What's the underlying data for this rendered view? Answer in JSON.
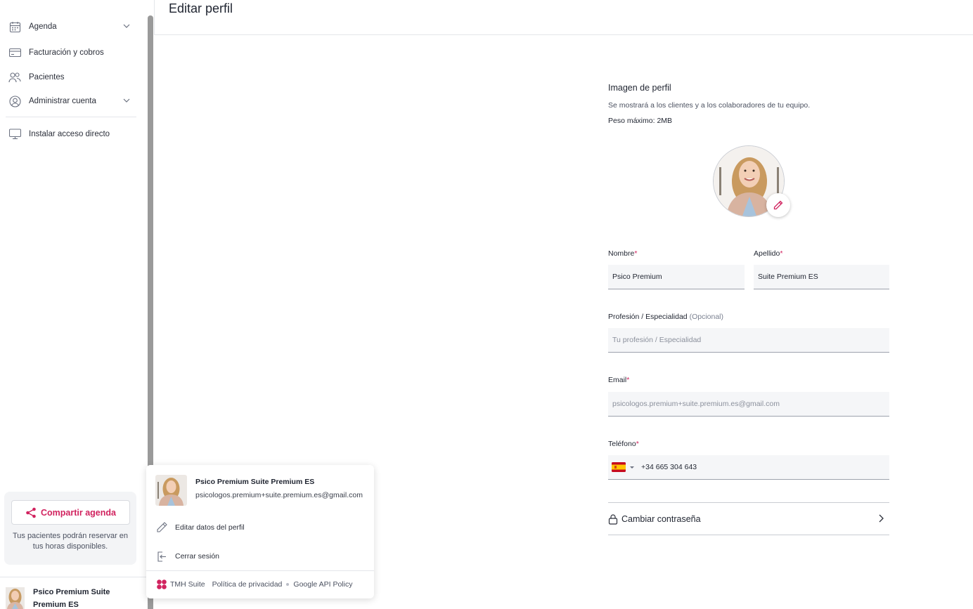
{
  "sidebar": {
    "items": [
      {
        "label": "Agenda",
        "icon": "calendar-icon"
      },
      {
        "label": "Facturación y cobros",
        "icon": "credit-card-icon"
      },
      {
        "label": "Pacientes",
        "icon": "users-icon"
      },
      {
        "label": "Administrar cuenta",
        "icon": "user-circle-icon"
      },
      {
        "label": "Instalar acceso directo",
        "icon": "monitor-icon"
      }
    ],
    "share": {
      "button_label": "Compartir agenda",
      "description": "Tus pacientes podrán reservar en tus horas disponibles."
    },
    "user_name": "Psico Premium Suite Premium ES"
  },
  "header": {
    "title": "Editar perfil"
  },
  "profile_image": {
    "title": "Imagen de perfil",
    "subtitle": "Se mostrará a los clientes y a los colaboradores de tu equipo.",
    "max_weight": "Peso máximo: 2MB"
  },
  "form": {
    "nombre": {
      "label": "Nombre",
      "required_mark": "*",
      "value": "Psico Premium"
    },
    "apellido": {
      "label": "Apellido",
      "required_mark": "*",
      "value": "Suite Premium ES"
    },
    "profesion": {
      "label": "Profesión / Especialidad",
      "optional": "(Opcional)",
      "placeholder": "Tu profesión / Especialidad"
    },
    "email": {
      "label": "Email",
      "required_mark": "*",
      "value": "psicologos.premium+suite.premium.es@gmail.com"
    },
    "telefono": {
      "label": "Teléfono",
      "required_mark": "*",
      "value": "+34 665 304 643",
      "country": "ES"
    },
    "change_password": "Cambiar contraseña"
  },
  "popup": {
    "name": "Psico Premium Suite Premium ES",
    "email": "psicologos.premium+suite.premium.es@gmail.com",
    "items": [
      {
        "label": "Editar datos del perfil",
        "icon": "pencil-icon"
      },
      {
        "label": "Cerrar sesión",
        "icon": "logout-icon"
      }
    ],
    "footer": {
      "brand": "TMH Suite",
      "privacy": "Política de privacidad",
      "google_policy": "Google API Policy"
    }
  },
  "colors": {
    "accent": "#d1235f",
    "field_bg": "#f5f6f8",
    "text": "#1f2430"
  }
}
